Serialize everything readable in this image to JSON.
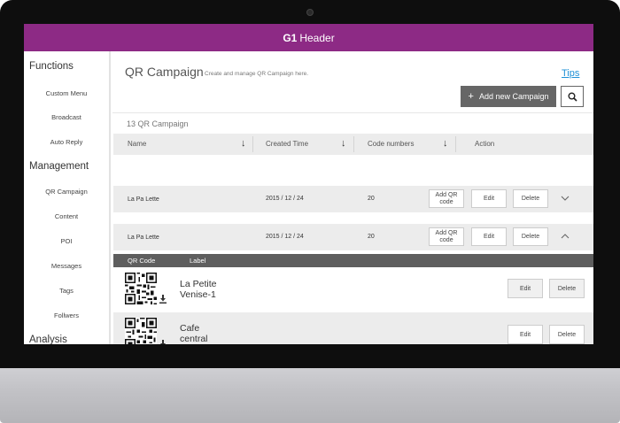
{
  "header": {
    "brand": "G1",
    "title": "Header"
  },
  "sidebar": {
    "sections": [
      {
        "title": "Functions",
        "items": [
          "Custom Menu",
          "Broadcast",
          "Auto Reply"
        ]
      },
      {
        "title": "Management",
        "items": [
          "QR Campaign",
          "Content",
          "POI",
          "Messages",
          "Tags",
          "Follwers"
        ]
      },
      {
        "title": "Analysis",
        "items": []
      }
    ]
  },
  "page": {
    "title": "QR Campaign",
    "subtitle": "Create and manage QR Campaign here.",
    "tips_link": "Tips",
    "add_button": "Add new Campaign",
    "count_text": "13 QR Campaign"
  },
  "table": {
    "columns": [
      "Name",
      "Created Time",
      "Code numbers",
      "Action"
    ],
    "rows": [
      {
        "name": "La Pa Lette",
        "created": "2015 / 12 / 24",
        "codes": "20",
        "add_qr": "Add QR code",
        "edit": "Edit",
        "delete": "Delete",
        "expanded": false
      },
      {
        "name": "La Pa Lette",
        "created": "2015 / 12 / 24",
        "codes": "20",
        "add_qr": "Add QR code",
        "edit": "Edit",
        "delete": "Delete",
        "expanded": true
      }
    ],
    "sub_columns": [
      "QR  Code",
      "Label"
    ],
    "qr_items": [
      {
        "label_line1": "La Petite",
        "label_line2": "Venise-1",
        "edit": "Edit",
        "delete": "Delete"
      },
      {
        "label_line1": "Cafe",
        "label_line2": "central",
        "edit": "Edit",
        "delete": "Delete"
      }
    ]
  },
  "colors": {
    "header": "#8d2a85",
    "tips": "#1e90d6",
    "primary_button": "#666666",
    "subheader": "#5e5e5e"
  },
  "icons": [
    "search-icon",
    "plus-icon",
    "sort-down-arrow-icon",
    "chevron-down-icon",
    "chevron-up-icon",
    "qr-code-icon",
    "download-icon"
  ]
}
